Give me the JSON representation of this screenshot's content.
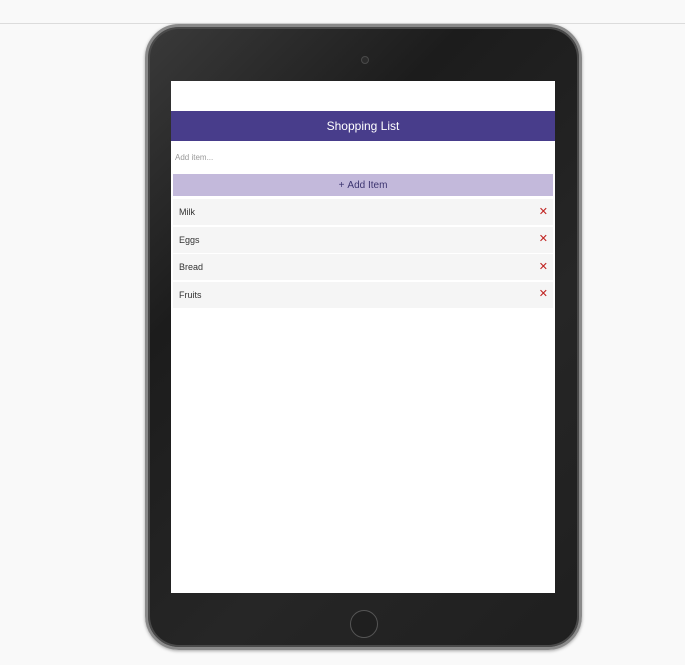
{
  "app": {
    "header_title": "Shopping List",
    "input_placeholder": "Add item...",
    "add_button_icon": "+",
    "add_button_label": "Add Item",
    "remove_icon": "✕"
  },
  "items": [
    {
      "label": "Milk"
    },
    {
      "label": "Eggs"
    },
    {
      "label": "Bread"
    },
    {
      "label": "Fruits"
    }
  ],
  "colors": {
    "header_bg": "#483d8b",
    "button_bg": "#c3b9db",
    "remove": "#c0211f"
  }
}
